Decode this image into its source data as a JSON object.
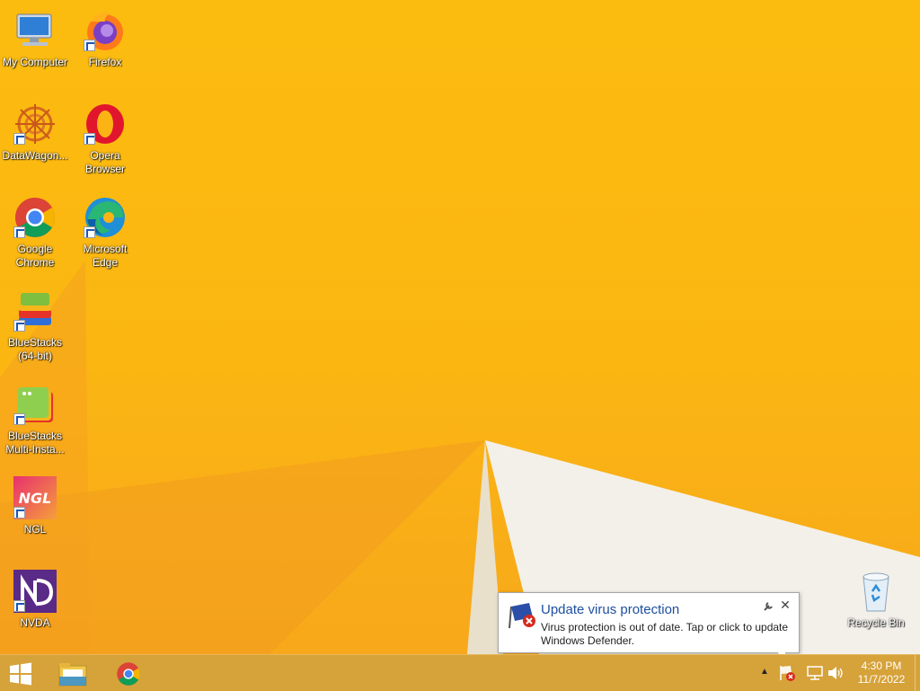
{
  "desktop": {
    "icons": [
      {
        "id": "my-computer",
        "label": "My Computer",
        "shortcut": false
      },
      {
        "id": "firefox",
        "label": "Firefox",
        "shortcut": true
      },
      {
        "id": "datawagon",
        "label": "DataWagon...",
        "shortcut": true
      },
      {
        "id": "opera",
        "label": "Opera\nBrowser",
        "shortcut": true
      },
      {
        "id": "chrome",
        "label": "Google\nChrome",
        "shortcut": true
      },
      {
        "id": "edge",
        "label": "Microsoft\nEdge",
        "shortcut": true
      },
      {
        "id": "bluestacks",
        "label": "BlueStacks\n(64-bit)",
        "shortcut": true
      },
      {
        "id": "bluestacks-multi",
        "label": "BlueStacks\nMulti-Insta...",
        "shortcut": true
      },
      {
        "id": "ngl",
        "label": "NGL",
        "shortcut": true,
        "glyph": "NGL"
      },
      {
        "id": "nvda",
        "label": "NVDA",
        "shortcut": true
      },
      {
        "id": "recycle-bin",
        "label": "Recycle Bin",
        "shortcut": false
      }
    ]
  },
  "notification": {
    "title": "Update virus protection",
    "body": "Virus protection is out of date. Tap or click to update Windows Defender.",
    "close_glyph": "✕"
  },
  "taskbar": {
    "tray_chevron_glyph": "▲",
    "time": "4:30 PM",
    "date": "11/7/2022"
  },
  "colors": {
    "wallpaper": "#fbb413",
    "taskbar": "#d6a23a",
    "notification_title": "#1e4fa0"
  }
}
